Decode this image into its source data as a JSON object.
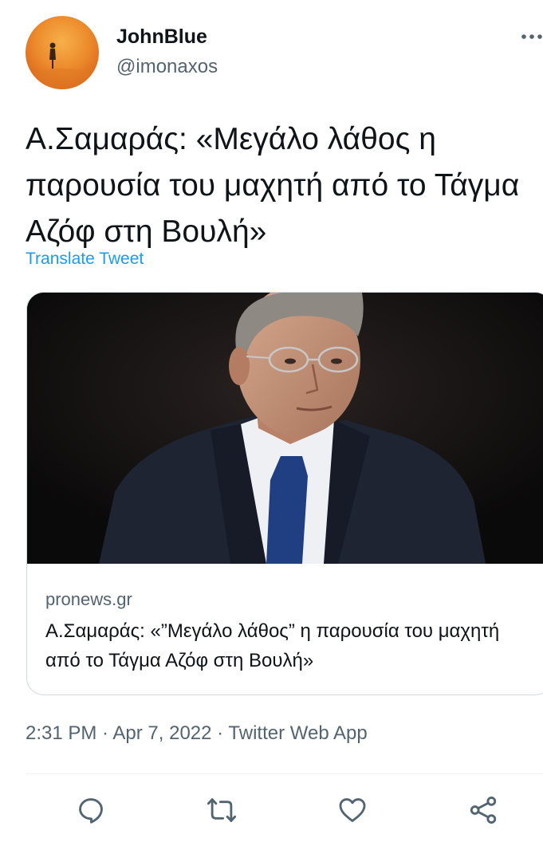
{
  "user": {
    "display_name": "JohnBlue",
    "handle": "@imonaxos"
  },
  "header": {
    "more_icon": "more-horizontal-icon"
  },
  "tweet": {
    "text": "Α.Σαμαράς: «Μεγάλο λάθος η παρουσία του μαχητή από το Τάγμα Αζόφ στη Βουλή»",
    "translate_label": "Translate Tweet"
  },
  "card": {
    "domain": "pronews.gr",
    "title": "Α.Σαμαράς: «”Μεγάλο λάθος” η παρουσία του μαχητή από το Τάγμα Αζόφ στη Βουλή»"
  },
  "meta": {
    "time": "2:31 PM",
    "separator": " · ",
    "date": "Apr 7, 2022",
    "source": "Twitter Web App"
  },
  "actions": [
    {
      "name": "reply",
      "icon": "reply-icon"
    },
    {
      "name": "retweet",
      "icon": "retweet-icon"
    },
    {
      "name": "like",
      "icon": "heart-icon"
    },
    {
      "name": "share",
      "icon": "share-icon"
    }
  ],
  "colors": {
    "accent": "#1d9bf0",
    "secondary_text": "#536471",
    "border": "#cfd9de",
    "avatar_bg": "#ec8a2c"
  }
}
